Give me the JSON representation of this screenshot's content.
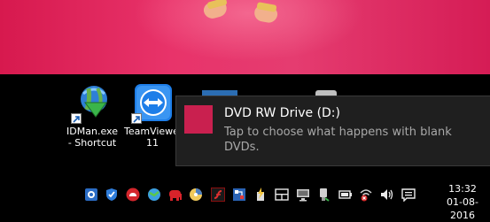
{
  "desktop": {
    "icons": [
      {
        "label": "IDMan.exe - Shortcut",
        "icon": "idm-icon"
      },
      {
        "label": "TeamViewer 11",
        "icon": "teamviewer-icon"
      }
    ]
  },
  "notification": {
    "title": "DVD RW Drive (D:)",
    "message": "Tap to choose what happens with blank DVDs.",
    "accent_color": "#c9204f"
  },
  "taskbar": {
    "tray_icons": [
      "settings-tray-icon",
      "security-shield-icon",
      "cloud-app-icon",
      "globe-sync-icon",
      "elephant-app-icon",
      "disk-app-icon",
      "flash-player-icon",
      "network-scan-icon",
      "power-tray-icon",
      "windows-tray-icon",
      "monitor-tray-icon",
      "usb-device-icon",
      "battery-icon",
      "network-disconnected-icon",
      "volume-icon",
      "action-center-icon"
    ],
    "clock": {
      "time": "13:32",
      "date": "01-08-2016"
    }
  }
}
